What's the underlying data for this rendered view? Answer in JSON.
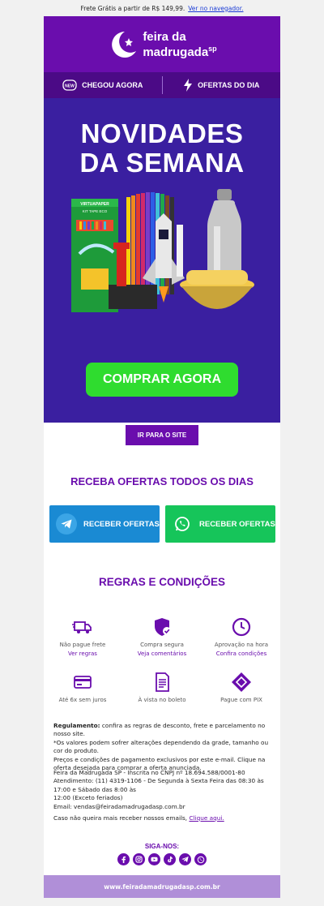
{
  "topbar": {
    "text": "Frete Grátis a partir de R$ 149,99.",
    "link": "Ver no navegador."
  },
  "header": {
    "brand_line1": "feira da",
    "brand_line2": "madrugada",
    "brand_sp": "sp"
  },
  "nav": {
    "item1": "CHEGOU AGORA",
    "item1_badge": "NEW",
    "item2": "OFERTAS DO DIA"
  },
  "hero": {
    "title_line1": "NOVIDADES",
    "title_line2": "DA SEMANA",
    "box_brand": "VIRTUAPAPER",
    "box_label": "KIT TAPE ECO",
    "cta": "COMPRAR AGORA"
  },
  "site_button": "IR PARA O SITE",
  "ofertas": {
    "title": "RECEBA OFERTAS TODOS OS DIAS",
    "telegram_label": "RECEBER OFERTAS",
    "whatsapp_label": "RECEBER OFERTAS"
  },
  "regras": {
    "title": "REGRAS E CONDIÇÕES",
    "features": [
      {
        "text": "Não pague frete",
        "link": "Ver regras",
        "icon": "truck-icon"
      },
      {
        "text": "Compra segura",
        "link": "Veja comentários",
        "icon": "shield-check-icon"
      },
      {
        "text": "Aprovação na hora",
        "link": "Confira condições",
        "icon": "clock-icon"
      },
      {
        "text": "Até 6x sem juros",
        "icon": "credit-card-icon"
      },
      {
        "text": "À vista no boleto",
        "icon": "invoice-icon"
      },
      {
        "text": "Pague com PIX",
        "icon": "pix-icon"
      }
    ]
  },
  "fine_print": {
    "regulamento_label": "Regulamento:",
    "regulamento_text": " confira as regras de desconto, frete e parcelamento no nosso site.",
    "line2": "*Os valores podem sofrer alterações dependendo da grade, tamanho ou cor do produto.",
    "line3": "Preços e condições de pagamento exclusivos por este e-mail. Clique na oferta desejada para comprar a oferta anunciada.",
    "company": "Feira da Madrugada SP - Inscrita no CNPJ nº 18.694.588/0001-80",
    "atendimento": "Atendimento: (11) 4319-1106 - De Segunda à Sexta Feira das 08:30 às 17:00 e Sábado das 8:00 às",
    "atendimento2": "12:00 (Exceto feriados)",
    "email": "Email: vendas@feiradamadrugadasp.com.br",
    "unsubscribe_text": "Caso não queira mais receber nossos emails, ",
    "unsubscribe_link": "Clique aqui."
  },
  "social": {
    "title": "SIGA-NOS:",
    "icons": [
      "facebook-icon",
      "instagram-icon",
      "youtube-icon",
      "tiktok-icon",
      "telegram-icon",
      "whatsapp-icon"
    ]
  },
  "footer": {
    "url": "www.feiradamadrugadasp.com.br"
  },
  "colors": {
    "purple": "#6a0dad",
    "hero_bg": "#3a1fa0",
    "cta_green": "#2fdc2f",
    "telegram": "#1a8ad3",
    "whatsapp": "#16c55a",
    "footer": "#b08fd8"
  }
}
